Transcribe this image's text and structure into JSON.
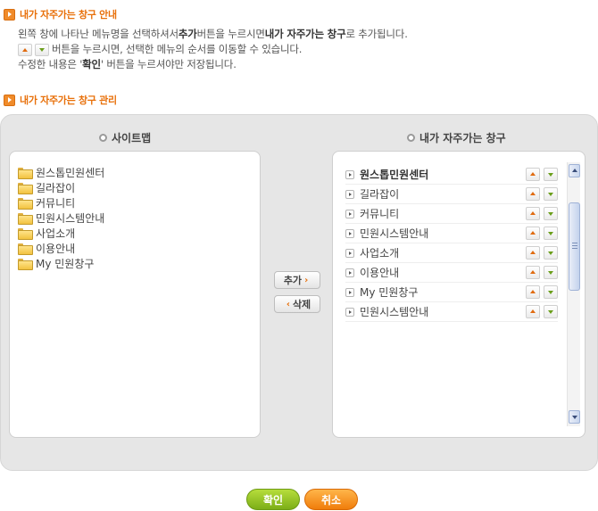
{
  "guide": {
    "title": "내가 자주가는 창구 안내",
    "line1": {
      "part1": "왼쪽 창에 나타난 메뉴명을 선택하셔서 ",
      "bold1": "추가",
      "part2": " 버튼을 누르시면 ",
      "bold2": "내가 자주가는 창구",
      "part3": "로 추가됩니다."
    },
    "line2": "버튼을 누르시면, 선택한 메뉴의 순서를 이동할 수 있습니다.",
    "line3": {
      "part1": "수정한 내용은 '",
      "bold": "확인",
      "part2": "' 버튼을 누르셔야만 저장됩니다."
    }
  },
  "manage": {
    "title": "내가 자주가는 창구 관리"
  },
  "sitemap": {
    "header": "사이트맵",
    "items": [
      "원스톱민원센터",
      "길라잡이",
      "커뮤니티",
      "민원시스템안내",
      "사업소개",
      "이용안내",
      "My 민원창구"
    ]
  },
  "actions": {
    "add": "추가",
    "remove": "삭제"
  },
  "favorites": {
    "header": "내가 자주가는 창구",
    "items": [
      "원스톱민원센터",
      "길라잡이",
      "커뮤니티",
      "민원시스템안내",
      "사업소개",
      "이용안내",
      "My 민원창구",
      "민원시스템안내"
    ]
  },
  "footer": {
    "confirm": "확인",
    "cancel": "취소"
  },
  "colors": {
    "accent": "#e8700a",
    "confirm": "#8dbd1f",
    "cancel": "#f58a1a"
  }
}
